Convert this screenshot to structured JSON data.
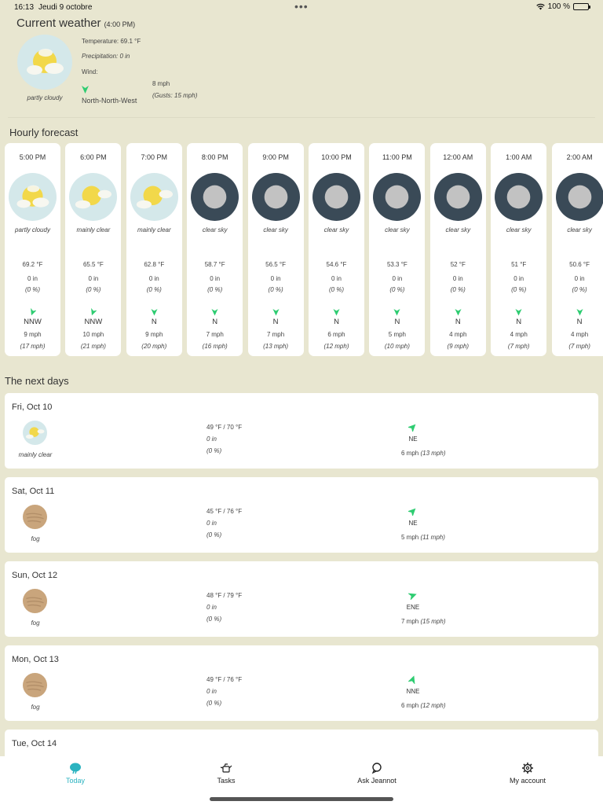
{
  "status_bar": {
    "time": "16:13",
    "date": "Jeudi 9 octobre",
    "battery": "100 %"
  },
  "current": {
    "title": "Current weather",
    "time": "(4:00 PM)",
    "condition": "partly cloudy",
    "icon": "partly-cloudy-icon",
    "temperature": "Temperature: 69.1 °F",
    "precipitation": "Precipitation: 0 in",
    "wind_label": "Wind:",
    "wind_direction": "North-North-West",
    "wind_speed": "8 mph",
    "gusts": "(Gusts: 15 mph)"
  },
  "hourly_title": "Hourly forecast",
  "hourly": [
    {
      "time": "5:00 PM",
      "condition": "partly cloudy",
      "icon": "partly-cloudy-icon",
      "temp": "69.2 °F",
      "precip": "0 in",
      "pct": "(0 %)",
      "dir": "NNW",
      "speed": "9 mph",
      "gust": "(17 mph)"
    },
    {
      "time": "6:00 PM",
      "condition": "mainly clear",
      "icon": "mainly-clear-icon",
      "temp": "65.5 °F",
      "precip": "0 in",
      "pct": "(0 %)",
      "dir": "NNW",
      "speed": "10 mph",
      "gust": "(21 mph)"
    },
    {
      "time": "7:00 PM",
      "condition": "mainly clear",
      "icon": "mainly-clear-icon",
      "temp": "62.8 °F",
      "precip": "0 in",
      "pct": "(0 %)",
      "dir": "N",
      "speed": "9 mph",
      "gust": "(20 mph)"
    },
    {
      "time": "8:00 PM",
      "condition": "clear sky",
      "icon": "clear-night-icon",
      "temp": "58.7 °F",
      "precip": "0 in",
      "pct": "(0 %)",
      "dir": "N",
      "speed": "7 mph",
      "gust": "(16 mph)"
    },
    {
      "time": "9:00 PM",
      "condition": "clear sky",
      "icon": "clear-night-icon",
      "temp": "56.5 °F",
      "precip": "0 in",
      "pct": "(0 %)",
      "dir": "N",
      "speed": "7 mph",
      "gust": "(13 mph)"
    },
    {
      "time": "10:00 PM",
      "condition": "clear sky",
      "icon": "clear-night-icon",
      "temp": "54.6 °F",
      "precip": "0 in",
      "pct": "(0 %)",
      "dir": "N",
      "speed": "6 mph",
      "gust": "(12 mph)"
    },
    {
      "time": "11:00 PM",
      "condition": "clear sky",
      "icon": "clear-night-icon",
      "temp": "53.3 °F",
      "precip": "0 in",
      "pct": "(0 %)",
      "dir": "N",
      "speed": "5 mph",
      "gust": "(10 mph)"
    },
    {
      "time": "12:00 AM",
      "condition": "clear sky",
      "icon": "clear-night-icon",
      "temp": "52 °F",
      "precip": "0 in",
      "pct": "(0 %)",
      "dir": "N",
      "speed": "4 mph",
      "gust": "(9 mph)"
    },
    {
      "time": "1:00 AM",
      "condition": "clear sky",
      "icon": "clear-night-icon",
      "temp": "51 °F",
      "precip": "0 in",
      "pct": "(0 %)",
      "dir": "N",
      "speed": "4 mph",
      "gust": "(7 mph)"
    },
    {
      "time": "2:00 AM",
      "condition": "clear sky",
      "icon": "clear-night-icon",
      "temp": "50.6 °F",
      "precip": "0 in",
      "pct": "(0 %)",
      "dir": "N",
      "speed": "4 mph",
      "gust": "(7 mph)"
    }
  ],
  "daily_title": "The next days",
  "daily": [
    {
      "date": "Fri, Oct 10",
      "condition": "mainly clear",
      "icon": "mainly-clear-icon",
      "temps": "49 °F / 70 °F",
      "precip": "0 in",
      "pct": "(0 %)",
      "dir": "NE",
      "speed": "6 mph",
      "gust": "(13 mph)"
    },
    {
      "date": "Sat, Oct 11",
      "condition": "fog",
      "icon": "fog-icon",
      "temps": "45 °F / 76 °F",
      "precip": "0 in",
      "pct": "(0 %)",
      "dir": "NE",
      "speed": "5 mph",
      "gust": "(11 mph)"
    },
    {
      "date": "Sun, Oct 12",
      "condition": "fog",
      "icon": "fog-icon",
      "temps": "48 °F / 79 °F",
      "precip": "0 in",
      "pct": "(0 %)",
      "dir": "ENE",
      "speed": "7 mph",
      "gust": "(15 mph)"
    },
    {
      "date": "Mon, Oct 13",
      "condition": "fog",
      "icon": "fog-icon",
      "temps": "49 °F / 76 °F",
      "precip": "0 in",
      "pct": "(0 %)",
      "dir": "NNE",
      "speed": "6 mph",
      "gust": "(12 mph)"
    },
    {
      "date": "Tue, Oct 14"
    }
  ],
  "tabs": [
    {
      "label": "Today",
      "icon": "weather-icon",
      "active": true
    },
    {
      "label": "Tasks",
      "icon": "watering-can-icon",
      "active": false
    },
    {
      "label": "Ask Jeannot",
      "icon": "chat-icon",
      "active": false
    },
    {
      "label": "My account",
      "icon": "gear-icon",
      "active": false
    }
  ],
  "colors": {
    "background": "#e8e6d0",
    "accent": "#2bb3c0",
    "wind_arrow": "#2ecc71",
    "night_icon": "#3a4a57"
  }
}
